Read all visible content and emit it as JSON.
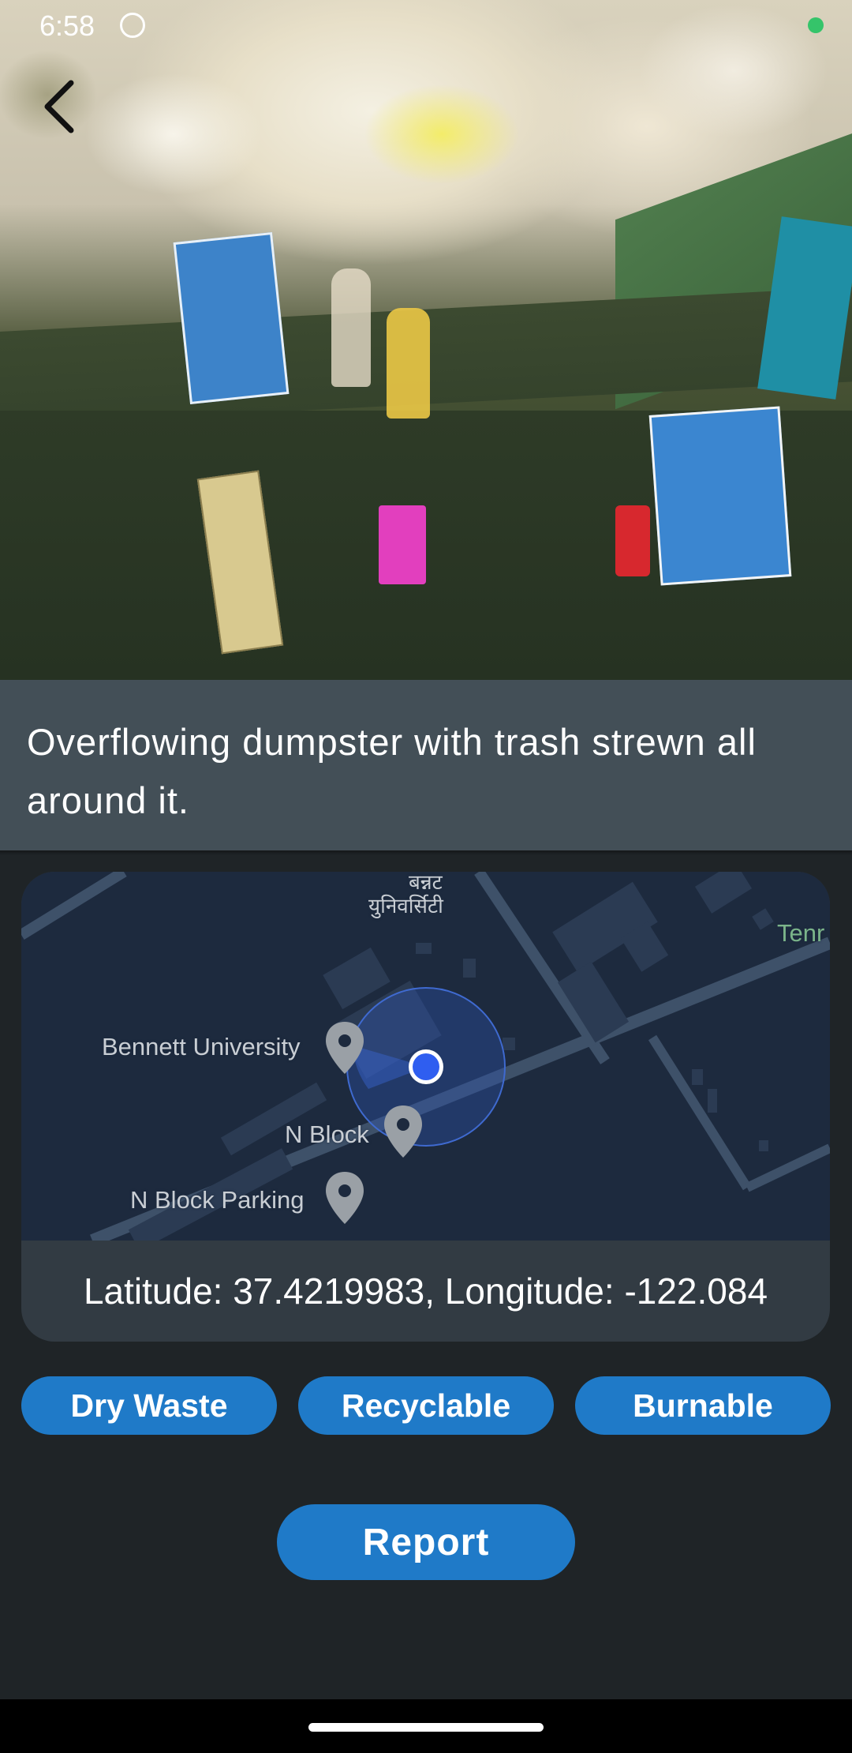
{
  "status_bar": {
    "time": "6:58"
  },
  "report": {
    "description": "Overflowing dumpster with trash strewn all around it.",
    "coordinates_text": "Latitude: 37.4219983, Longitude: -122.084"
  },
  "map": {
    "labels": {
      "top_hindi_1": "बन्नट",
      "top_hindi_2": "युनिवर्सिटी",
      "tenr": "Tenr",
      "bennett": "Bennett University",
      "n_block": "N Block",
      "n_block_parking": "N Block Parking"
    }
  },
  "categories": [
    {
      "label": "Dry Waste"
    },
    {
      "label": "Recyclable"
    },
    {
      "label": "Burnable"
    }
  ],
  "actions": {
    "report_label": "Report"
  },
  "colors": {
    "accent": "#1f7ac8",
    "description_bg": "#434f57",
    "page_bg": "#1f2427",
    "map_bg": "#1d2a3e",
    "location_dot": "#2f5ef0"
  }
}
